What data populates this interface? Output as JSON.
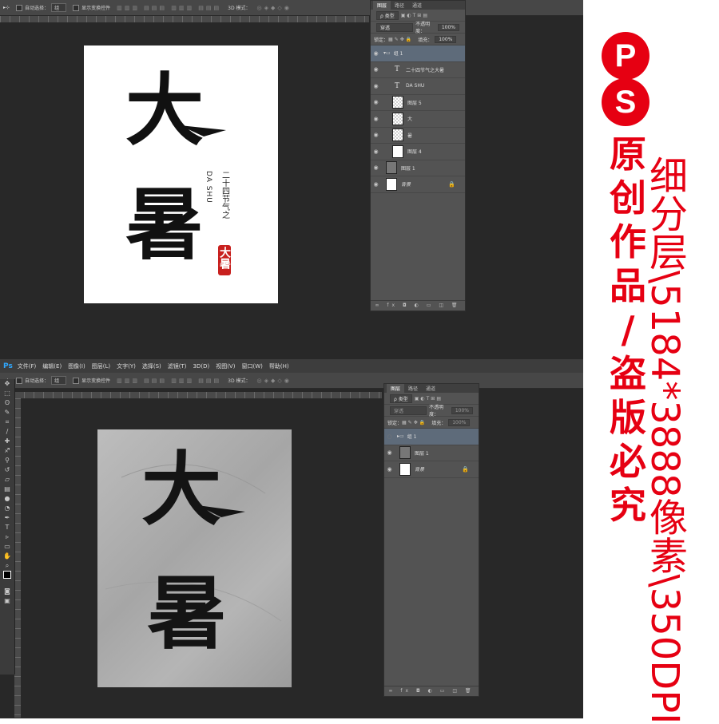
{
  "menubar": {
    "app_logo": "Ps",
    "items": [
      "文件(F)",
      "编辑(E)",
      "图像(I)",
      "图层(L)",
      "文字(Y)",
      "选择(S)",
      "滤镜(T)",
      "3D(D)",
      "视图(V)",
      "窗口(W)",
      "帮助(H)"
    ]
  },
  "options_bar": {
    "auto_select_label": "自动选择：",
    "auto_select_value": "组",
    "show_transform_label": "显示变换控件",
    "mode_3d_label": "3D 模式："
  },
  "top_screenshot": {
    "poster": {
      "big_char_1": "大",
      "big_char_2": "暑",
      "vertical_cn": "二十四节气之",
      "vertical_en": "DA SHU",
      "seal_chars": "大暑"
    },
    "layers_panel": {
      "tabs": [
        "图层",
        "路径",
        "通道"
      ],
      "filter_label": "ρ 类型",
      "blend_mode": "穿透",
      "opacity_label": "不透明度：",
      "opacity_value": "100%",
      "lock_label": "锁定：",
      "fill_label": "填充：",
      "fill_value": "100%",
      "group_name": "组 1",
      "layers": [
        {
          "kind": "text",
          "name": "二十四节气之大暑"
        },
        {
          "kind": "text",
          "name": "DA SHU"
        },
        {
          "kind": "raster",
          "name": "图层 5"
        },
        {
          "kind": "raster",
          "name": "大"
        },
        {
          "kind": "raster",
          "name": "暑"
        },
        {
          "kind": "raster",
          "name": "图层 4"
        }
      ],
      "below_group": [
        {
          "kind": "raster",
          "name": "图层 1"
        },
        {
          "kind": "background",
          "name": "背景"
        }
      ]
    }
  },
  "bottom_screenshot": {
    "paper": {
      "big_char_1": "大",
      "big_char_2": "暑"
    },
    "layers_panel": {
      "tabs": [
        "图层",
        "路径",
        "通道"
      ],
      "filter_label": "ρ 类型",
      "blend_mode": "穿透",
      "opacity_label": "不透明度：",
      "opacity_value": "100%",
      "lock_label": "锁定：",
      "fill_label": "填充：",
      "fill_value": "100%",
      "group_name": "组 1",
      "layers": [
        {
          "kind": "raster",
          "name": "图层 1"
        },
        {
          "kind": "background",
          "name": "背景"
        }
      ]
    }
  },
  "promo": {
    "badge_1": "P",
    "badge_2": "S",
    "vertical_chars": [
      "原",
      "创",
      "作",
      "品",
      "/",
      "盗",
      "版",
      "必",
      "究"
    ],
    "spec_text": "细分层\\5184*3888像素\\350DPI"
  },
  "colors": {
    "promo_red": "#e60012",
    "ps_dark": "#282828",
    "ps_panel": "#535353",
    "seal_red": "#c8201e"
  }
}
